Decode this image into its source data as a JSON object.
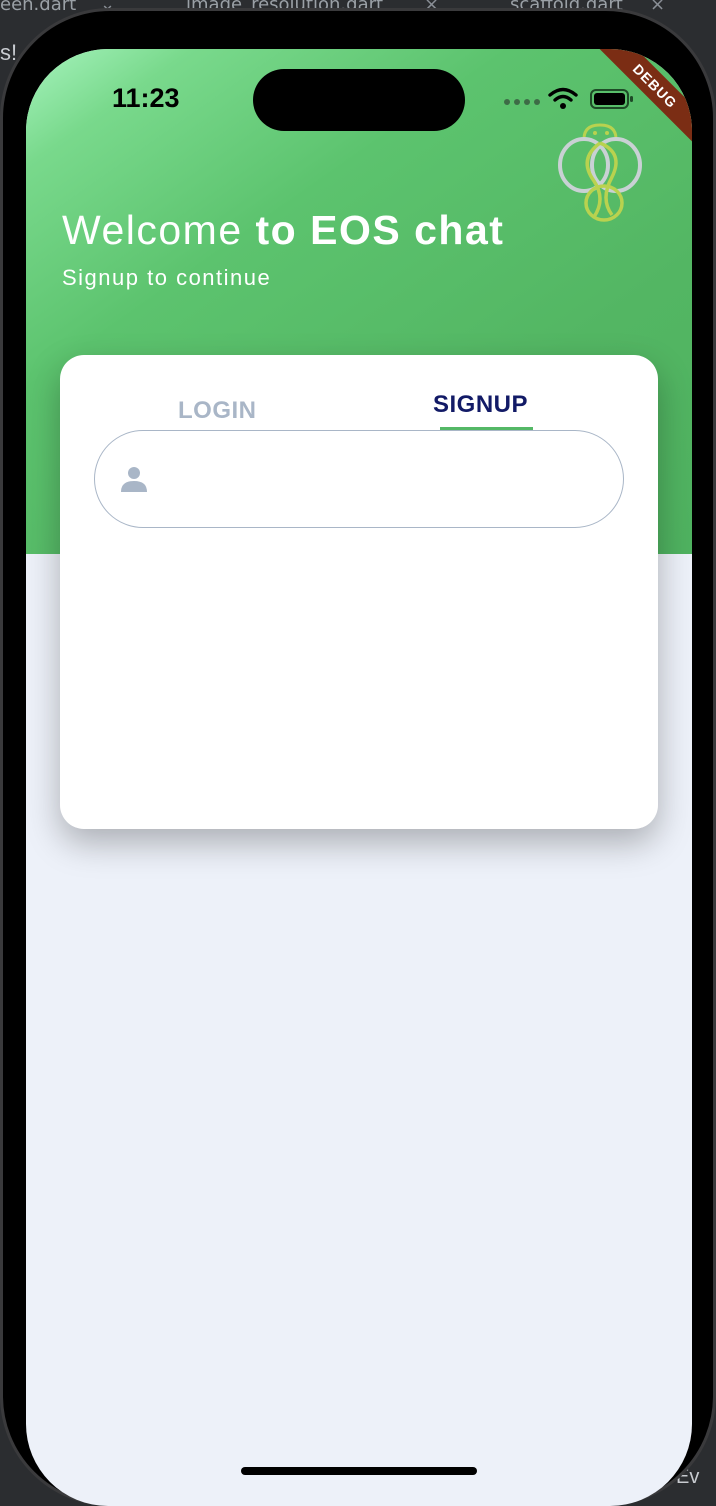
{
  "ide": {
    "tab1": "een.dart",
    "tab2": "image_resolution.dart",
    "tab3": "scaffold.dart",
    "side_text": "s!",
    "bottom_text": "Ev"
  },
  "status_bar": {
    "time": "11:23"
  },
  "debug_banner": "DEBUG",
  "header": {
    "welcome_prefix": "Welcome ",
    "welcome_bold": "to EOS chat",
    "subtitle": "Signup to continue"
  },
  "tabs": {
    "login_label": "LOGIN",
    "signup_label": "SIGNUP",
    "selected": "SIGNUP"
  },
  "form": {
    "name_value": "",
    "name_placeholder": ""
  },
  "colors": {
    "header_green": "#54b866",
    "selected_tab": "#121a66",
    "unselected_tab": "#a9b6c7",
    "indicator": "#54b866",
    "background": "#edf1f9"
  },
  "icons": {
    "field": "person-icon",
    "logo": "eos-logo-icon"
  }
}
